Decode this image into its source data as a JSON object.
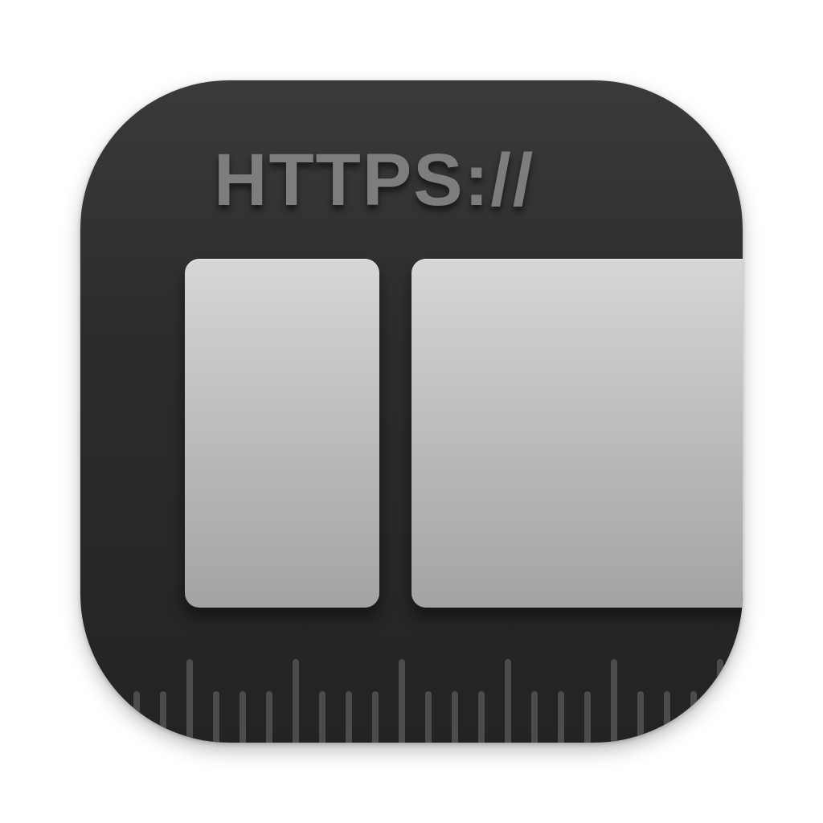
{
  "icon": {
    "scheme_text": "HTTPS://",
    "colors": {
      "background_top": "#3a3a3c",
      "background_bottom": "#232325",
      "text": "#7d7d7f",
      "pane_light": "#d6d6d8",
      "pane_dark": "#a3a3a5",
      "ruler_tick": "#4c4c4e"
    },
    "ruler": {
      "tick_count": 23,
      "major_every": 4
    }
  }
}
